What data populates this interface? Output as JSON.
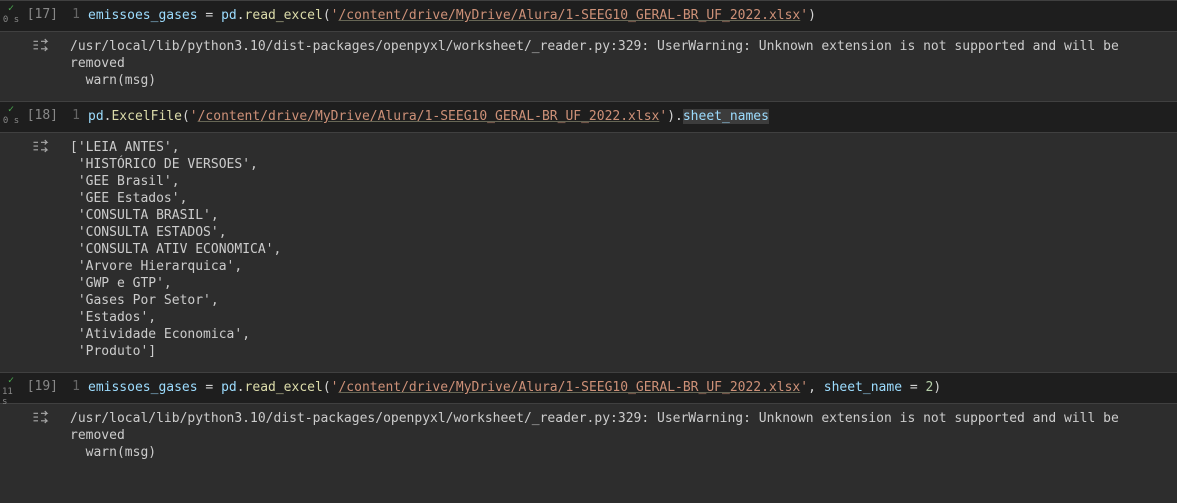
{
  "cells": [
    {
      "prompt": "[17]",
      "timing": "0 s",
      "line_no": "1",
      "code": {
        "var": "emissoes_gases",
        "eq": " = ",
        "mod": "pd",
        "dot": ".",
        "fn": "read_excel",
        "open": "(",
        "q1": "'",
        "path": "/content/drive/MyDrive/Alura/1-SEEG10_GERAL-BR_UF_2022.xlsx",
        "q2": "'",
        "close": ")"
      },
      "output": "/usr/local/lib/python3.10/dist-packages/openpyxl/worksheet/_reader.py:329: UserWarning: Unknown extension is not supported and will be removed\n  warn(msg)"
    },
    {
      "prompt": "[18]",
      "timing": "0 s",
      "line_no": "1",
      "code": {
        "mod": "pd",
        "dot": ".",
        "fn": "ExcelFile",
        "open": "(",
        "q1": "'",
        "path": "/content/drive/MyDrive/Alura/1-SEEG10_GERAL-BR_UF_2022.xlsx",
        "q2": "'",
        "close": ")",
        "dot2": ".",
        "attr": "sheet_names"
      },
      "output": "['LEIA ANTES',\n 'HISTÓRICO DE VERSOES',\n 'GEE Brasil',\n 'GEE Estados',\n 'CONSULTA BRASIL',\n 'CONSULTA ESTADOS',\n 'CONSULTA ATIV ECONOMICA',\n 'Arvore Hierarquica',\n 'GWP e GTP',\n 'Gases Por Setor',\n 'Estados',\n 'Atividade Economica',\n 'Produto']",
      "sheet_names": [
        "LEIA ANTES",
        "HISTÓRICO DE VERSOES",
        "GEE Brasil",
        "GEE Estados",
        "CONSULTA BRASIL",
        "CONSULTA ESTADOS",
        "CONSULTA ATIV ECONOMICA",
        "Arvore Hierarquica",
        "GWP e GTP",
        "Gases Por Setor",
        "Estados",
        "Atividade Economica",
        "Produto"
      ]
    },
    {
      "prompt": "[19]",
      "timing": "11 s",
      "line_no": "1",
      "code": {
        "var": "emissoes_gases",
        "eq": " = ",
        "mod": "pd",
        "dot": ".",
        "fn": "read_excel",
        "open": "(",
        "q1": "'",
        "path": "/content/drive/MyDrive/Alura/1-SEEG10_GERAL-BR_UF_2022.xlsx",
        "q2": "'",
        "comma": ", ",
        "arg": "sheet_name",
        "eq2": " = ",
        "val": "2",
        "close": ")"
      },
      "output": "/usr/local/lib/python3.10/dist-packages/openpyxl/worksheet/_reader.py:329: UserWarning: Unknown extension is not supported and will be removed\n  warn(msg)"
    }
  ]
}
